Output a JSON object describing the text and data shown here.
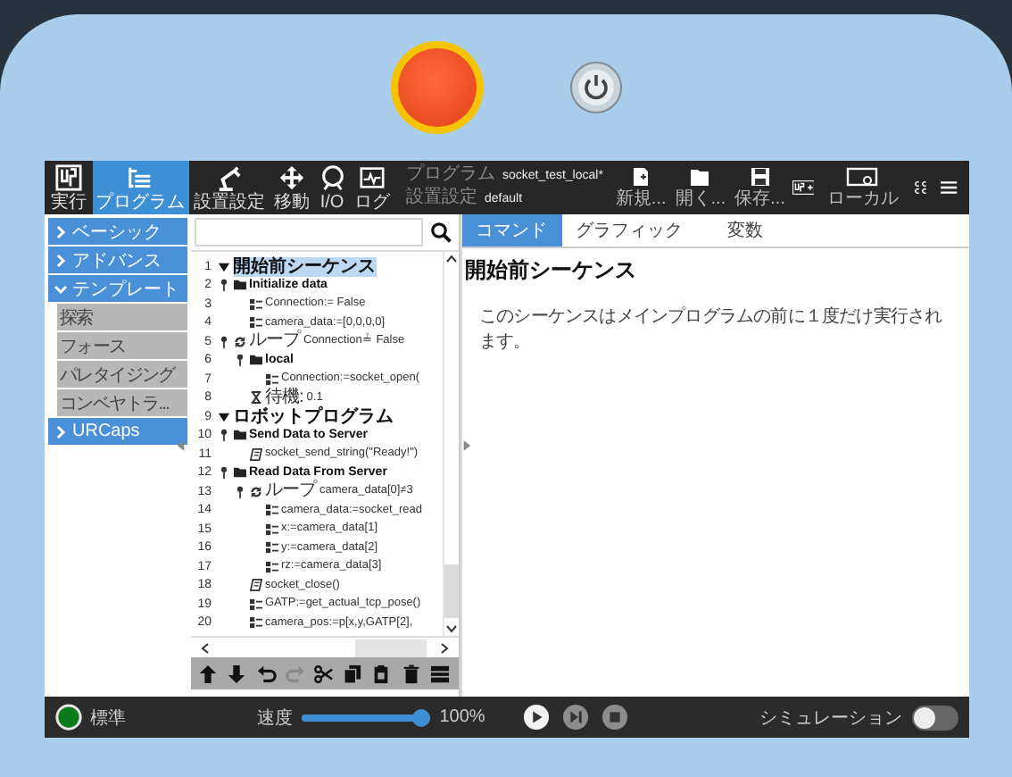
{
  "header": {
    "nav": [
      {
        "label": "実行",
        "selected": false
      },
      {
        "label": "プログラム",
        "selected": true
      },
      {
        "label": "設置設定",
        "selected": false
      },
      {
        "label": "移動",
        "selected": false
      },
      {
        "label": "I/O",
        "selected": false
      },
      {
        "label": "ログ",
        "selected": false
      }
    ],
    "program": {
      "label": "プログラム",
      "value": "socket_test_local*"
    },
    "installation": {
      "label": "設置設定",
      "value": "default"
    },
    "file_buttons": [
      {
        "label": "新規..."
      },
      {
        "label": "開く..."
      },
      {
        "label": "保存..."
      }
    ],
    "local": {
      "label": "ローカル"
    }
  },
  "sidebar": [
    {
      "label": "ベーシック",
      "expanded": false
    },
    {
      "label": "アドバンス",
      "expanded": false
    },
    {
      "label": "テンプレート",
      "expanded": true,
      "children": [
        {
          "label": "探索"
        },
        {
          "label": "フォース"
        },
        {
          "label": "パレタイジング"
        },
        {
          "label": "コンベヤトラ..."
        }
      ]
    },
    {
      "label": "URCaps",
      "expanded": false
    }
  ],
  "tree": [
    {
      "num": "1",
      "kind": "section",
      "text": "開始前シーケンス",
      "expanded": true,
      "selected": true,
      "children": [
        {
          "num": "2",
          "kind": "folder",
          "text": "Initialize data",
          "expanded": true,
          "selected": false,
          "children": [
            {
              "num": "3",
              "kind": "assign",
              "text": "Connection:= False",
              "selected": false
            },
            {
              "num": "4",
              "kind": "assign",
              "text": "camera_data:=[0,0,0,0]",
              "selected": false
            }
          ]
        },
        {
          "num": "5",
          "kind": "loop",
          "keyword": "ループ",
          "text": "Connection≟ False",
          "expanded": true,
          "selected": false,
          "children": [
            {
              "num": "6",
              "kind": "folder",
              "text": "local",
              "expanded": true,
              "selected": false,
              "children": [
                {
                  "num": "7",
                  "kind": "assign",
                  "text": "Connection:=socket_open(",
                  "selected": false
                }
              ]
            },
            {
              "num": "8",
              "kind": "wait",
              "keyword": "待機:",
              "text": "0.1",
              "selected": false
            }
          ]
        }
      ]
    },
    {
      "num": "9",
      "kind": "section",
      "text": "ロボットプログラム",
      "expanded": true,
      "selected": false,
      "children": [
        {
          "num": "10",
          "kind": "folder",
          "text": "Send Data to Server",
          "expanded": true,
          "selected": false,
          "children": [
            {
              "num": "11",
              "kind": "script",
              "text": "socket_send_string(\"Ready!\")",
              "selected": false
            }
          ]
        },
        {
          "num": "12",
          "kind": "folder",
          "text": "Read Data From Server",
          "expanded": true,
          "selected": false,
          "children": [
            {
              "num": "13",
              "kind": "loop",
              "keyword": "ループ",
              "text": "camera_data[0]≠3",
              "expanded": true,
              "selected": false,
              "children": [
                {
                  "num": "14",
                  "kind": "assign",
                  "text": "camera_data:=socket_read",
                  "selected": false
                },
                {
                  "num": "15",
                  "kind": "assign",
                  "text": "x:=camera_data[1]",
                  "selected": false
                },
                {
                  "num": "16",
                  "kind": "assign",
                  "text": "y:=camera_data[2]",
                  "selected": false
                },
                {
                  "num": "17",
                  "kind": "assign",
                  "text": "rz:=camera_data[3]",
                  "selected": false
                }
              ]
            },
            {
              "num": "18",
              "kind": "script",
              "text": "socket_close()",
              "selected": false
            },
            {
              "num": "19",
              "kind": "assign",
              "text": "GATP:=get_actual_tcp_pose()",
              "selected": false
            },
            {
              "num": "20",
              "kind": "assign",
              "text": "camera_pos:=p[x,y,GATP[2],",
              "selected": false
            }
          ]
        }
      ]
    }
  ],
  "tabs": [
    {
      "label": "コマンド",
      "selected": true
    },
    {
      "label": "グラフィック",
      "selected": false
    },
    {
      "label": "変数",
      "selected": false
    }
  ],
  "content": {
    "title": "開始前シーケンス",
    "description": "このシーケンスはメインプログラムの前に１度だけ実行されます。"
  },
  "bottom": {
    "status": "標準",
    "speed": {
      "label": "速度",
      "level": 1.0,
      "reading": "100%"
    },
    "simulation": {
      "label": "シミュレーション",
      "on": false
    }
  }
}
